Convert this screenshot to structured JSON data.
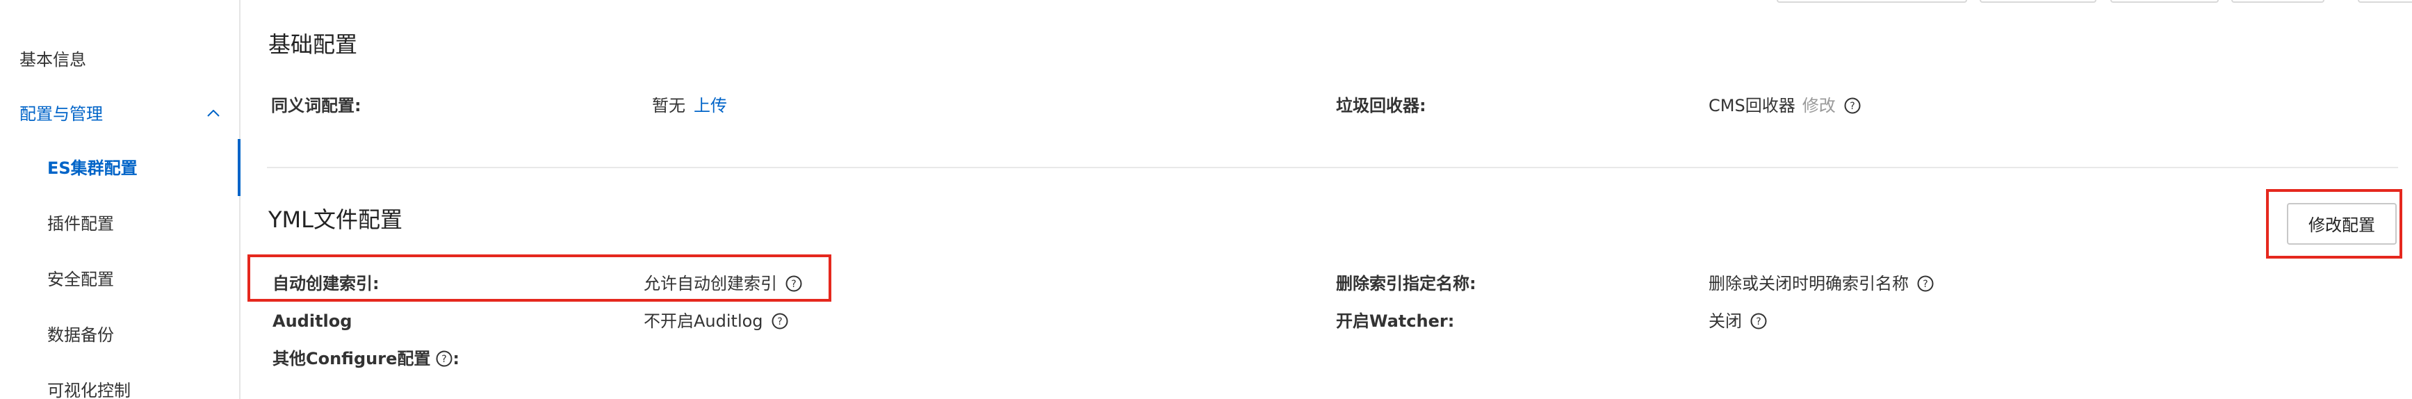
{
  "sidebar": {
    "items": [
      {
        "label": "基本信息"
      },
      {
        "label": "配置与管理"
      },
      {
        "label": "ES集群配置"
      },
      {
        "label": "插件配置"
      },
      {
        "label": "安全配置"
      },
      {
        "label": "数据备份"
      },
      {
        "label": "可视化控制"
      }
    ]
  },
  "basic_config": {
    "title": "基础配置",
    "synonym_label": "同义词配置:",
    "synonym_value": "暂无",
    "synonym_action": "上传",
    "gc_label": "垃圾回收器:",
    "gc_value": "CMS回收器",
    "gc_action": "修改"
  },
  "yml_config": {
    "title": "YML文件配置",
    "modify_button": "修改配置",
    "auto_index_label": "自动创建索引:",
    "auto_index_value": "允许自动创建索引",
    "delete_index_label": "删除索引指定名称:",
    "delete_index_value": "删除或关闭时明确索引名称",
    "auditlog_label": "Auditlog",
    "auditlog_value": "不开启Auditlog",
    "watcher_label": "开启Watcher:",
    "watcher_value": "关闭",
    "other_label": "其他Configure配置"
  },
  "colors": {
    "accent": "#0064c8",
    "highlight": "#e5281e",
    "muted": "#9a9a9a"
  },
  "icons": [
    "chevron-up-icon",
    "help-icon"
  ]
}
